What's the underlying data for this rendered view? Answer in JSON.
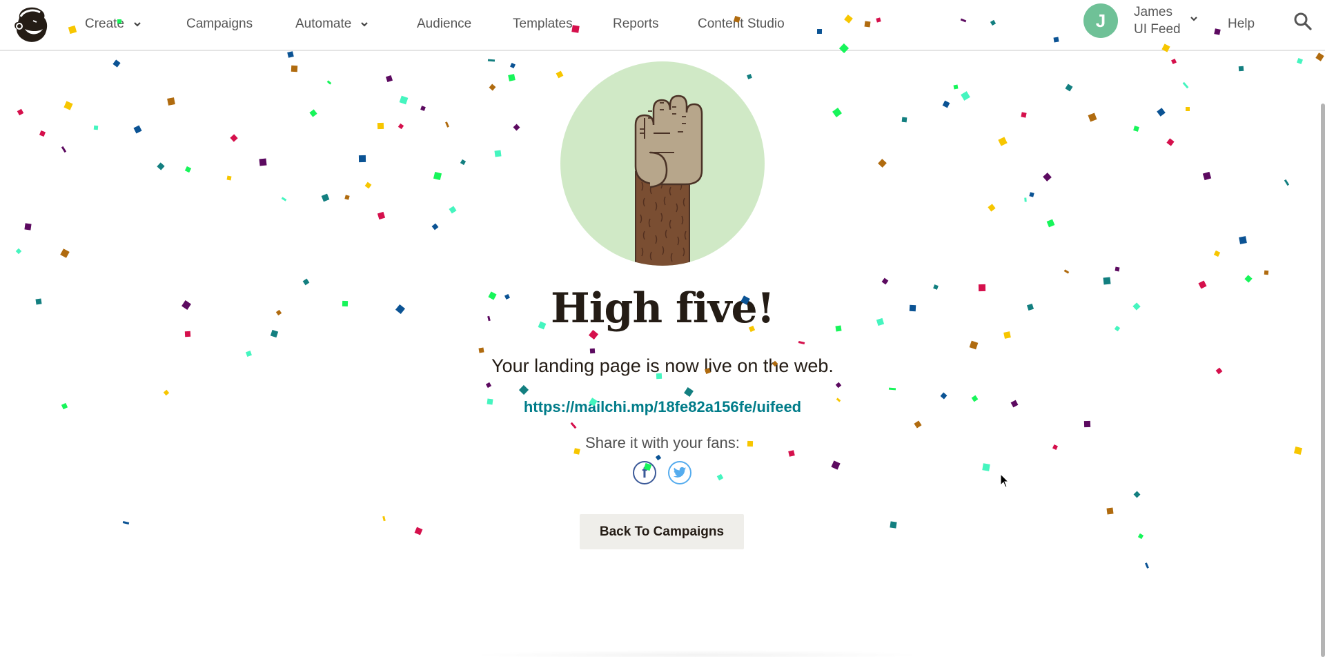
{
  "nav": {
    "items": [
      {
        "label": "Create",
        "has_dropdown": true
      },
      {
        "label": "Campaigns",
        "has_dropdown": false
      },
      {
        "label": "Automate",
        "has_dropdown": true
      },
      {
        "label": "Audience",
        "has_dropdown": false
      },
      {
        "label": "Templates",
        "has_dropdown": false
      },
      {
        "label": "Reports",
        "has_dropdown": false
      },
      {
        "label": "Content Studio",
        "has_dropdown": false
      }
    ],
    "account": {
      "avatar_initial": "J",
      "avatar_color": "#6fc197",
      "name": "James",
      "org": "UI Feed"
    },
    "help_label": "Help",
    "logo_icon": "mailchimp-freddie-logo",
    "search_icon": "search-icon"
  },
  "main": {
    "illustration": "high-five-hand-illustration",
    "title": "High five!",
    "subtitle": "Your landing page is now live on the web.",
    "url": "https://mailchi.mp/18fe82a156fe/uifeed",
    "share_label": "Share it with your fans:",
    "social": [
      {
        "name": "facebook",
        "glyph": "f",
        "color": "#3b5998"
      },
      {
        "name": "twitter",
        "color": "#55acee"
      }
    ],
    "back_button_label": "Back To Campaigns"
  },
  "colors": {
    "link": "#007c89",
    "hero_circle": "#d0e9c6",
    "button_bg": "#efeeea"
  },
  "confetti_palette": [
    "#0b5394",
    "#137f80",
    "#d5104c",
    "#17f55a",
    "#45f5bf",
    "#f7c600",
    "#b06b0f",
    "#5c0a60"
  ]
}
